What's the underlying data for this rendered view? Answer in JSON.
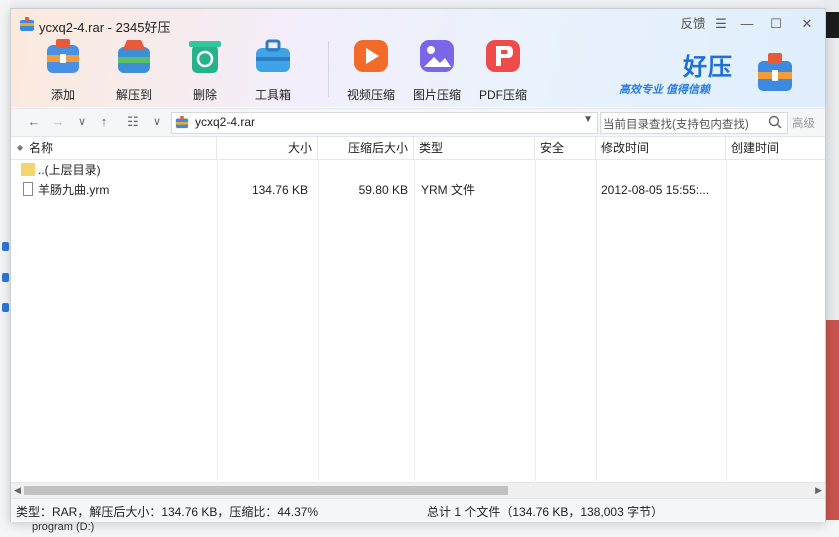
{
  "background": {
    "bottom_label": "program (D:)"
  },
  "window": {
    "title": "ycxq2-4.rar - 2345好压",
    "titlebar": {
      "feedback": "反馈",
      "menu": "☰",
      "minimize": "—",
      "maximize": "☐",
      "close": "✕"
    }
  },
  "toolbar": {
    "tools": [
      {
        "label": "添加",
        "icon": "add-archive-icon",
        "color": "#4a90e2"
      },
      {
        "label": "解压到",
        "icon": "extract-icon",
        "color": "#3e8fd8"
      },
      {
        "label": "删除",
        "icon": "recycle-icon",
        "color": "#27b38a"
      },
      {
        "label": "工具箱",
        "icon": "toolbox-icon",
        "color": "#3fa3e8"
      },
      {
        "label": "视频压缩",
        "icon": "video-compress-icon",
        "color": "#f26b2a"
      },
      {
        "label": "图片压缩",
        "icon": "image-compress-icon",
        "color": "#7a67e8"
      },
      {
        "label": "PDF压缩",
        "icon": "pdf-compress-icon",
        "color": "#ee4b4b"
      }
    ],
    "brand": {
      "name": "好压",
      "slogan": "高效专业  值得信赖"
    }
  },
  "navbar": {
    "path": "ycxq2-4.rar",
    "search_placeholder": "当前目录查找(支持包内查找)",
    "advanced": "高级"
  },
  "columns": [
    "名称",
    "大小",
    "压缩后大小",
    "类型",
    "安全",
    "修改时间",
    "创建时间"
  ],
  "rows": [
    {
      "name": "..(上层目录)",
      "size": "",
      "packed": "",
      "type": "",
      "security": "",
      "modified": "",
      "kind": "folder"
    },
    {
      "name": "羊肠九曲.yrm",
      "size": "134.76 KB",
      "packed": "59.80 KB",
      "type": "YRM 文件",
      "security": "",
      "modified": "2012-08-05 15:55:...",
      "kind": "file"
    }
  ],
  "status": {
    "left": "类型：RAR，解压后大小：134.76 KB，压缩比：44.37%",
    "right": "总计 1 个文件（134.76 KB，138,003 字节）"
  },
  "colors": {
    "accent": "#1f6fd8",
    "folder": "#f4d46c"
  }
}
